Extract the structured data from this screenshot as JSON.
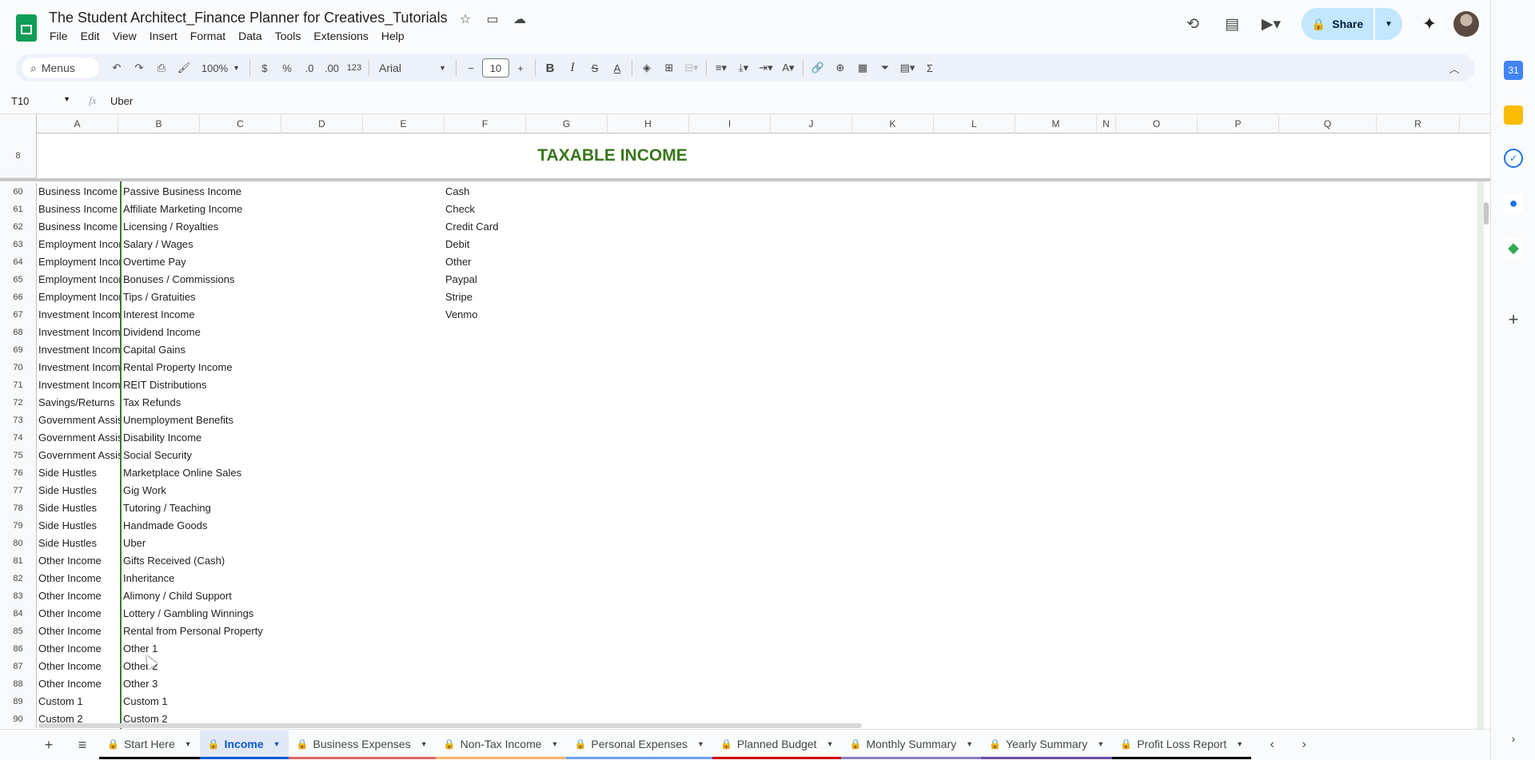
{
  "document": {
    "title": "The Student Architect_Finance Planner for Creatives_Tutorials"
  },
  "menu": [
    "File",
    "Edit",
    "View",
    "Insert",
    "Format",
    "Data",
    "Tools",
    "Extensions",
    "Help"
  ],
  "header": {
    "share_label": "Share"
  },
  "toolbar": {
    "search_label": "Menus",
    "zoom": "100%",
    "currency": "$",
    "percent": "%",
    "decrease_decimal": ".0",
    "increase_decimal": ".00",
    "number_format": "123",
    "font": "Arial",
    "font_size": "10",
    "bold": "B",
    "italic": "I",
    "sum": "Σ"
  },
  "formula_bar": {
    "cell_ref": "T10",
    "value": "Uber"
  },
  "columns": [
    "A",
    "B",
    "C",
    "D",
    "E",
    "F",
    "G",
    "H",
    "I",
    "J",
    "K",
    "L",
    "M",
    "N",
    "O",
    "P",
    "Q",
    "R"
  ],
  "frozen_row": {
    "number": "8",
    "title": "TAXABLE INCOME"
  },
  "rows": [
    {
      "n": "60",
      "a": "Business Income",
      "b": "Passive Business Income",
      "f": "Cash"
    },
    {
      "n": "61",
      "a": "Business Income",
      "b": "Affiliate Marketing Income",
      "f": "Check"
    },
    {
      "n": "62",
      "a": "Business Income",
      "b": "Licensing / Royalties",
      "f": "Credit Card"
    },
    {
      "n": "63",
      "a": "Employment Income",
      "b": "Salary / Wages",
      "f": "Debit"
    },
    {
      "n": "64",
      "a": "Employment Income",
      "b": "Overtime Pay",
      "f": "Other"
    },
    {
      "n": "65",
      "a": "Employment Income",
      "b": "Bonuses / Commissions",
      "f": "Paypal"
    },
    {
      "n": "66",
      "a": "Employment Income",
      "b": "Tips / Gratuities",
      "f": "Stripe"
    },
    {
      "n": "67",
      "a": "Investment Income",
      "b": "Interest Income",
      "f": "Venmo"
    },
    {
      "n": "68",
      "a": "Investment Income",
      "b": "Dividend Income",
      "f": ""
    },
    {
      "n": "69",
      "a": "Investment Income",
      "b": "Capital Gains",
      "f": ""
    },
    {
      "n": "70",
      "a": "Investment Income",
      "b": "Rental Property Income",
      "f": ""
    },
    {
      "n": "71",
      "a": "Investment Income",
      "b": "REIT Distributions",
      "f": ""
    },
    {
      "n": "72",
      "a": "Savings/Returns",
      "b": "Tax Refunds",
      "f": ""
    },
    {
      "n": "73",
      "a": "Government Assistance",
      "b": "Unemployment Benefits",
      "f": ""
    },
    {
      "n": "74",
      "a": "Government Assistance",
      "b": "Disability Income",
      "f": ""
    },
    {
      "n": "75",
      "a": "Government Assistance",
      "b": "Social Security",
      "f": ""
    },
    {
      "n": "76",
      "a": "Side Hustles",
      "b": "Marketplace Online Sales",
      "f": ""
    },
    {
      "n": "77",
      "a": "Side Hustles",
      "b": "Gig Work",
      "f": ""
    },
    {
      "n": "78",
      "a": "Side Hustles",
      "b": "Tutoring / Teaching",
      "f": ""
    },
    {
      "n": "79",
      "a": "Side Hustles",
      "b": "Handmade Goods",
      "f": ""
    },
    {
      "n": "80",
      "a": "Side Hustles",
      "b": "Uber",
      "f": ""
    },
    {
      "n": "81",
      "a": "Other Income",
      "b": "Gifts Received (Cash)",
      "f": ""
    },
    {
      "n": "82",
      "a": "Other Income",
      "b": "Inheritance",
      "f": ""
    },
    {
      "n": "83",
      "a": "Other Income",
      "b": "Alimony / Child Support",
      "f": ""
    },
    {
      "n": "84",
      "a": "Other Income",
      "b": "Lottery / Gambling Winnings",
      "f": ""
    },
    {
      "n": "85",
      "a": "Other Income",
      "b": "Rental from Personal Property",
      "f": ""
    },
    {
      "n": "86",
      "a": "Other Income",
      "b": "Other 1",
      "f": ""
    },
    {
      "n": "87",
      "a": "Other Income",
      "b": "Other 2",
      "f": ""
    },
    {
      "n": "88",
      "a": "Other Income",
      "b": "Other 3",
      "f": ""
    },
    {
      "n": "89",
      "a": "Custom 1",
      "b": "Custom 1",
      "f": ""
    },
    {
      "n": "90",
      "a": "Custom 2",
      "b": "Custom 2",
      "f": ""
    }
  ],
  "tabs": [
    {
      "label": "Start Here",
      "color": "#000000",
      "active": false
    },
    {
      "label": "Income",
      "color": "#0b57d0",
      "active": true
    },
    {
      "label": "Business Expenses",
      "color": "#e06666",
      "active": false
    },
    {
      "label": "Non-Tax Income",
      "color": "#f6b26b",
      "active": false
    },
    {
      "label": "Personal Expenses",
      "color": "#6d9eeb",
      "active": false
    },
    {
      "label": "Planned Budget",
      "color": "#cc0000",
      "active": false
    },
    {
      "label": "Monthly Summary",
      "color": "#8e7cc3",
      "active": false
    },
    {
      "label": "Yearly Summary",
      "color": "#674ea7",
      "active": false
    },
    {
      "label": "Profit Loss Report",
      "color": "#000000",
      "active": false
    }
  ],
  "colors": {
    "title_green": "#38761d",
    "share_bg": "#c2e7ff",
    "active_tab": "#0b57d0"
  }
}
